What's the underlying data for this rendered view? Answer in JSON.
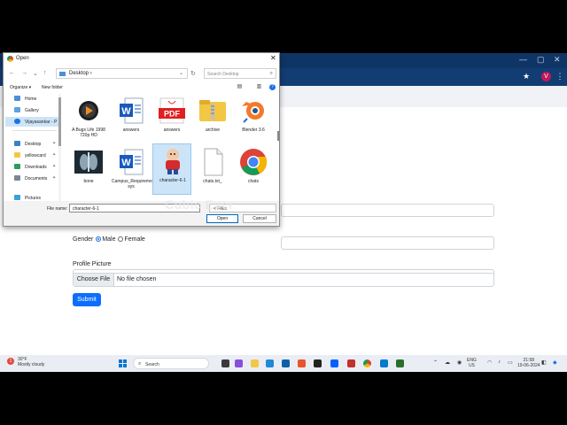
{
  "dialog": {
    "title": "Open",
    "close": "✕",
    "address": "Desktop",
    "address_sep": "›",
    "search_placeholder": "Search Desktop",
    "organize": "Organize ▾",
    "new_folder": "New folder",
    "nav": [
      "Home",
      "Gallery",
      "Vijayasankar - P",
      "Desktop",
      "yellowcard",
      "Downloads",
      "Documents",
      "Pictures"
    ],
    "files": [
      {
        "label": "A Bugs Life 1998 720p HD",
        "icon": "video-icon"
      },
      {
        "label": "answers",
        "icon": "word-doc-icon"
      },
      {
        "label": "answers",
        "icon": "pdf-icon"
      },
      {
        "label": "archive",
        "icon": "folder-zip-icon"
      },
      {
        "label": "Blender 3.6",
        "icon": "blender-icon"
      },
      {
        "label": "bone",
        "icon": "xray-image-icon"
      },
      {
        "label": "Campus_Requirement_Management sys",
        "icon": "word-doc-icon"
      },
      {
        "label": "character-6-1",
        "icon": "cartoon-image-icon"
      },
      {
        "label": "chats.txt_",
        "icon": "blank-file-icon"
      },
      {
        "label": "chats",
        "icon": "chrome-icon"
      }
    ],
    "filename_label": "File name:",
    "filename_value": "character-6-1",
    "filetype_value": "< Files",
    "open_label": "Open",
    "cancel_label": "Cancel"
  },
  "form": {
    "gender_label": "Gender",
    "male_label": "Male",
    "female_label": "Female",
    "profile_label": "Profile Picture",
    "choose_file": "Choose File",
    "no_file": "No file chosen",
    "submit": "Submit"
  },
  "browser": {
    "profile_initial": "V"
  },
  "watermark": "Cubic Ever",
  "taskbar": {
    "weather_temp": "30°F",
    "weather_desc": "Mostly cloudy",
    "weather_badge": "1",
    "search_placeholder": "Search",
    "lang": "ENG",
    "region": "US",
    "time": "21:58",
    "date": "19-06-2024"
  }
}
